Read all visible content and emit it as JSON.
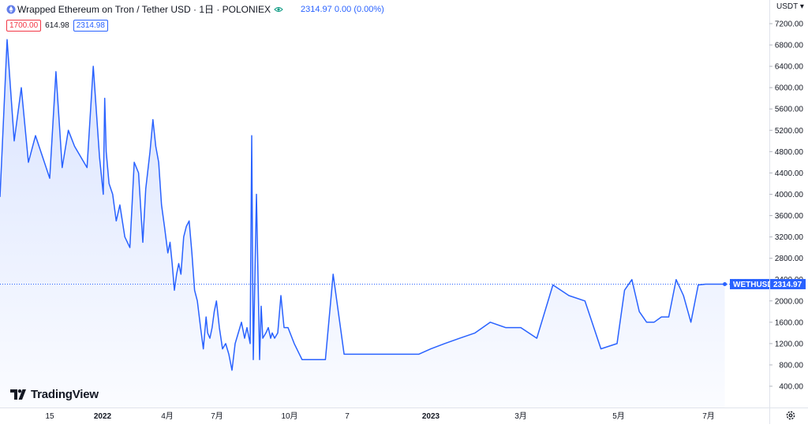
{
  "legend": {
    "title": "Wrapped Ethereum on Tron / Tether USD · 1日 · POLONIEX",
    "price": "2314.97 0.00 (0.00%)"
  },
  "price_box": {
    "sell": "1700.00",
    "spread": "614.98",
    "buy": "2314.98"
  },
  "currency": "USDT",
  "branding": {
    "logo_text": "TradingView"
  },
  "colors": {
    "line": "#2962ff",
    "fill": "#dbe4ff",
    "sell": "#f23645"
  },
  "chart_data": {
    "type": "area",
    "title": "Wrapped Ethereum on Tron / Tether USD · 1日 · POLONIEX",
    "xlabel": "",
    "ylabel": "",
    "ylim": [
      0,
      7500
    ],
    "xlim": [
      "2021-12-01",
      "2023-07-31"
    ],
    "y_ticks": [
      "400.00",
      "800.00",
      "1200.00",
      "1600.00",
      "2000.00",
      "2400.00",
      "2800.00",
      "3200.00",
      "3600.00",
      "4000.00",
      "4400.00",
      "4800.00",
      "5200.00",
      "5600.00",
      "6000.00",
      "6400.00",
      "6800.00",
      "7200.00"
    ],
    "y_tick_values": [
      400,
      800,
      1200,
      1600,
      2000,
      2400,
      2800,
      3200,
      3600,
      4000,
      4400,
      4800,
      5200,
      5600,
      6000,
      6400,
      6800,
      7200
    ],
    "x_ticks": [
      {
        "label": "15",
        "date": "2021-12-15",
        "bold": false
      },
      {
        "label": "2022",
        "date": "2022-01-01",
        "bold": true
      },
      {
        "label": "4月",
        "date": "2022-04-01",
        "bold": false
      },
      {
        "label": "7月",
        "date": "2022-07-01",
        "bold": false
      },
      {
        "label": "10月",
        "date": "2022-10-01",
        "bold": false
      },
      {
        "label": "7",
        "date": "2022-11-07",
        "bold": false
      },
      {
        "label": "2023",
        "date": "2023-01-01",
        "bold": true
      },
      {
        "label": "3月",
        "date": "2023-03-01",
        "bold": false
      },
      {
        "label": "5月",
        "date": "2023-05-01",
        "bold": false
      },
      {
        "label": "7月",
        "date": "2023-07-01",
        "bold": false
      }
    ],
    "series": [
      {
        "name": "WETHUSDT",
        "x": [
          "2021-12-01",
          "2021-12-03",
          "2021-12-05",
          "2021-12-07",
          "2021-12-09",
          "2021-12-11",
          "2021-12-13",
          "2021-12-15",
          "2021-12-17",
          "2021-12-19",
          "2021-12-21",
          "2021-12-23",
          "2021-12-25",
          "2021-12-27",
          "2021-12-29",
          "2021-12-31",
          "2022-01-02",
          "2022-01-04",
          "2022-01-06",
          "2022-01-10",
          "2022-01-15",
          "2022-01-20",
          "2022-01-25",
          "2022-02-01",
          "2022-02-08",
          "2022-02-14",
          "2022-02-20",
          "2022-02-26",
          "2022-03-02",
          "2022-03-08",
          "2022-03-12",
          "2022-03-16",
          "2022-03-20",
          "2022-03-24",
          "2022-03-28",
          "2022-04-02",
          "2022-04-06",
          "2022-04-10",
          "2022-04-14",
          "2022-04-18",
          "2022-04-22",
          "2022-04-26",
          "2022-05-01",
          "2022-05-06",
          "2022-05-11",
          "2022-05-16",
          "2022-05-21",
          "2022-05-26",
          "2022-06-01",
          "2022-06-06",
          "2022-06-11",
          "2022-06-14",
          "2022-06-18",
          "2022-06-22",
          "2022-06-26",
          "2022-06-30",
          "2022-07-04",
          "2022-07-08",
          "2022-07-12",
          "2022-07-16",
          "2022-07-20",
          "2022-07-24",
          "2022-07-28",
          "2022-08-01",
          "2022-08-05",
          "2022-08-08",
          "2022-08-12",
          "2022-08-14",
          "2022-08-16",
          "2022-08-20",
          "2022-08-24",
          "2022-08-26",
          "2022-08-28",
          "2022-09-01",
          "2022-09-04",
          "2022-09-07",
          "2022-09-09",
          "2022-09-12",
          "2022-09-16",
          "2022-09-20",
          "2022-09-24",
          "2022-09-29",
          "2022-10-04",
          "2022-10-09",
          "2022-10-14",
          "2022-10-19",
          "2022-10-24",
          "2022-10-29",
          "2022-11-05",
          "2022-11-12",
          "2022-11-19",
          "2022-11-26",
          "2022-12-03",
          "2022-12-10",
          "2022-12-17",
          "2022-12-24",
          "2023-01-01",
          "2023-01-10",
          "2023-01-20",
          "2023-01-30",
          "2023-02-09",
          "2023-02-19",
          "2023-03-01",
          "2023-03-11",
          "2023-03-21",
          "2023-03-31",
          "2023-04-10",
          "2023-04-20",
          "2023-04-30",
          "2023-05-05",
          "2023-05-10",
          "2023-05-15",
          "2023-05-20",
          "2023-05-25",
          "2023-05-30",
          "2023-06-04",
          "2023-06-09",
          "2023-06-14",
          "2023-06-19",
          "2023-06-24",
          "2023-06-29",
          "2023-07-04",
          "2023-07-09"
        ],
        "y": [
          3950,
          6900,
          5000,
          6000,
          4600,
          5100,
          4700,
          4300,
          6300,
          4500,
          5200,
          4900,
          4700,
          4500,
          6400,
          4700,
          4000,
          5800,
          4800,
          4200,
          4000,
          3500,
          3800,
          3200,
          3000,
          4600,
          4400,
          3100,
          4100,
          4800,
          5400,
          4900,
          4600,
          3800,
          3400,
          2900,
          3100,
          2700,
          2200,
          2500,
          2700,
          2500,
          3200,
          3400,
          3500,
          2900,
          2200,
          2000,
          1500,
          1100,
          1700,
          1400,
          1300,
          1500,
          1800,
          2000,
          1500,
          1100,
          1200,
          1000,
          700,
          1200,
          1400,
          1600,
          1300,
          1500,
          1200,
          5100,
          900,
          4000,
          900,
          1900,
          1300,
          1400,
          1500,
          1300,
          1400,
          1300,
          1400,
          2100,
          1500,
          1500,
          1200,
          900,
          900,
          900,
          900,
          2500,
          1000,
          1000,
          1000,
          1000,
          1000,
          1000,
          1000,
          1000,
          1100,
          1200,
          1300,
          1400,
          1600,
          1500,
          1500,
          1300,
          2300,
          2100,
          2000,
          1100,
          1200,
          2200,
          2400,
          1800,
          1600,
          1600,
          1700,
          1700,
          2400,
          2100,
          1600,
          2300,
          2314.97,
          2314.97,
          2314.97
        ]
      }
    ],
    "last_value_label": "WETHUSDT",
    "last_value": "2314.97",
    "grid": false,
    "legend": "top-left"
  }
}
